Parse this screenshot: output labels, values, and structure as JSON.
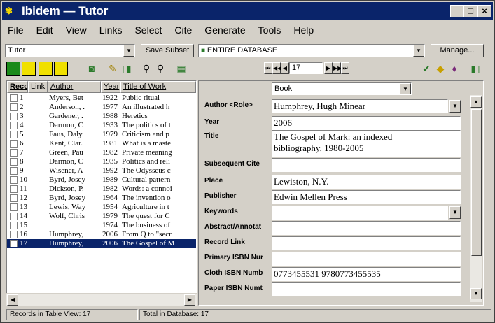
{
  "window": {
    "title": "Ibidem — Tutor",
    "logo": "Ibidem logo"
  },
  "menu": [
    "File",
    "Edit",
    "View",
    "Links",
    "Select",
    "Cite",
    "Generate",
    "Tools",
    "Help"
  ],
  "library": {
    "value": "Tutor"
  },
  "save_subset_label": "Save Subset",
  "database": {
    "value": "ENTIRE DATABASE"
  },
  "manage_label": "Manage...",
  "record_nav": {
    "value": "17",
    "icons": [
      "first-record-icon",
      "previous-page-icon",
      "previous-record-icon",
      "next-record-icon",
      "next-page-icon",
      "last-record-icon"
    ]
  },
  "table": {
    "headers": [
      "Reco",
      "Link",
      "Author",
      "Year",
      "Title of Work"
    ],
    "rows": [
      {
        "num": "1",
        "author": "Myers, Bet",
        "year": "1922",
        "title": "Public ritual"
      },
      {
        "num": "2",
        "author": "Anderson, .",
        "year": "1977",
        "title": "An illustrated h"
      },
      {
        "num": "3",
        "author": "Gardener, .",
        "year": "1988",
        "title": "Heretics"
      },
      {
        "num": "4",
        "author": "Darmon, C",
        "year": "1933",
        "title": "The politics of t"
      },
      {
        "num": "5",
        "author": "Faus, Daly.",
        "year": "1979",
        "title": "Criticism and p"
      },
      {
        "num": "6",
        "author": "Kent, Clar.",
        "year": "1981",
        "title": "What is a maste"
      },
      {
        "num": "7",
        "author": "Green, Pau",
        "year": "1982",
        "title": "Private meaning"
      },
      {
        "num": "8",
        "author": "Darmon, C",
        "year": "1935",
        "title": "Politics and reli"
      },
      {
        "num": "9",
        "author": "Wisener, A",
        "year": "1992",
        "title": "The Odysseus c"
      },
      {
        "num": "10",
        "author": "Byrd, Josey",
        "year": "1989",
        "title": "Cultural pattern"
      },
      {
        "num": "11",
        "author": "Dickson, P.",
        "year": "1982",
        "title": "Words: a connoi"
      },
      {
        "num": "12",
        "author": "Byrd, Josey",
        "year": "1964",
        "title": "The invention o"
      },
      {
        "num": "13",
        "author": "Lewis, Way",
        "year": "1954",
        "title": "Agriculture in t"
      },
      {
        "num": "14",
        "author": "Wolf, Chris",
        "year": "1979",
        "title": "The quest for C"
      },
      {
        "num": "15",
        "author": "",
        "year": "1974",
        "title": "The business of"
      },
      {
        "num": "16",
        "author": "Humphrey,",
        "year": "2006",
        "title": "From Q to \"secr"
      },
      {
        "num": "17",
        "author": "Humphrey,",
        "year": "2006",
        "title": "The Gospel of M"
      }
    ]
  },
  "record_type": {
    "value": "Book"
  },
  "fields": [
    {
      "label": "Author <Role>",
      "value": "Humphrey, Hugh Minear"
    },
    {
      "label": "Year",
      "value": "2006"
    },
    {
      "label": "Title",
      "value": "The Gospel of Mark: an indexed",
      "value2": "bibliography, 1980-2005"
    },
    {
      "label": "Subsequent Cite",
      "value": ""
    },
    {
      "label": "Place",
      "value": "Lewiston, N.Y."
    },
    {
      "label": "Publisher",
      "value": "Edwin Mellen Press"
    },
    {
      "label": "Keywords",
      "value": ""
    },
    {
      "label": "Abstract/Annotat",
      "value": ""
    },
    {
      "label": "Record Link",
      "value": ""
    },
    {
      "label": "Primary ISBN Nur",
      "value": ""
    },
    {
      "label": "Cloth ISBN Numb",
      "value": "0773455531 9780773455535"
    },
    {
      "label": "Paper ISBN Numt",
      "value": ""
    }
  ],
  "status": {
    "table_view": "Records in Table View: 17",
    "total": "Total in Database: 17"
  },
  "colors": {
    "title_bar": "#0a246a",
    "selection": "#0a246a",
    "face": "#d4d0c8"
  }
}
